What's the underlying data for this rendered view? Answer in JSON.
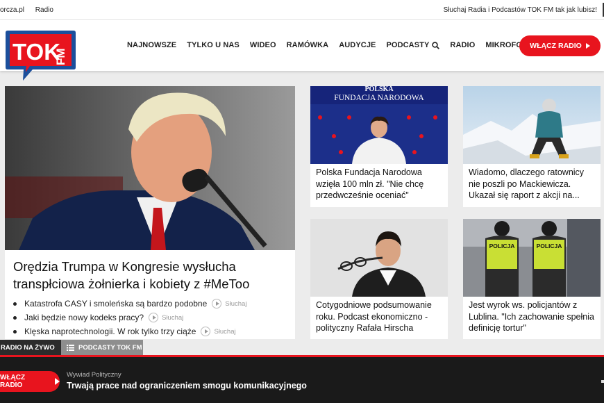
{
  "topbar": {
    "links": [
      "orcza.pl",
      "Radio"
    ],
    "tagline": "Słuchaj Radia i Podcastów TOK FM tak jak lubisz!"
  },
  "logo": {
    "main": "TOK",
    "sub": "FM"
  },
  "nav": {
    "items": [
      "NAJNOWSZE",
      "TYLKO U NAS",
      "WIDEO",
      "RAMÓWKA",
      "AUDYCJE",
      "PODCASTY",
      "RADIO",
      "MIKROFON"
    ],
    "search_icon": "search-icon"
  },
  "header_button": {
    "label": "WŁĄCZ RADIO"
  },
  "featured": {
    "title": "Orędzia Trumpa w Kongresie wysłucha transpłciowa żołnierka i kobiety z #MeToo",
    "listen_label": "Słuchaj",
    "bullets": [
      "Katastrofa CASY i smoleńska są bardzo podobne",
      "Jaki będzie nowy kodeks pracy?",
      "Klęska naprotechnologii. W rok tylko trzy ciąże"
    ]
  },
  "cards": [
    {
      "title": "Polska Fundacja Narodowa wzięła 100 mln zł. \"Nie chcę przedwcześnie oceniać\"",
      "image_text": [
        "POLSKA",
        "FUNDACJA NARODOWA"
      ]
    },
    {
      "title": "Wiadomo, dlaczego ratownicy nie poszli po Mackiewicza. Ukazał się raport z akcji na..."
    },
    {
      "title": "Cotygodniowe podsumowanie roku. Podcast ekonomiczno - polityczny Rafała Hirscha"
    },
    {
      "title": "Jest wyrok ws. policjantów z Lublina. \"Ich zachowanie spełnia definicję tortur\"",
      "image_text": [
        "POLICJA",
        "POLICJA"
      ]
    }
  ],
  "player": {
    "tabs": [
      "RADIO NA ŻYWO",
      "PODCASTY TOK FM"
    ],
    "button_label": "WŁĄCZ RADIO",
    "program": "Wywiad Polityczny",
    "now_playing": "Trwają prace nad ograniczeniem smogu komunikacyjnego"
  },
  "colors": {
    "accent": "#e8141e",
    "logo_blue": "#1b4f9c",
    "dark": "#1a1a1a"
  }
}
